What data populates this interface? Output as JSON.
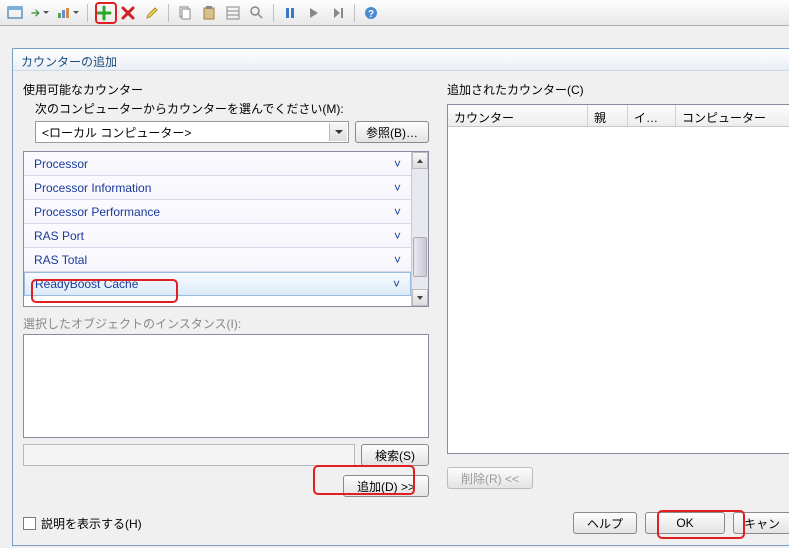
{
  "toolbar": {
    "icons": [
      "view-window",
      "arrow-right",
      "graph-type",
      "plus",
      "delete-x",
      "pencil",
      "copy",
      "paste",
      "clipboard",
      "zoom",
      "pause",
      "play",
      "step",
      "help"
    ]
  },
  "dialog": {
    "title": "カウンターの追加",
    "left": {
      "available_label": "使用可能なカウンター",
      "computer_label": "次のコンピューターからカウンターを選んでください(M):",
      "computer_value": "<ローカル コンピューター>",
      "browse_btn": "参照(B)…",
      "counters": [
        "Processor",
        "Processor Information",
        "Processor Performance",
        "RAS Port",
        "RAS Total",
        "ReadyBoost Cache"
      ],
      "instance_label": "選択したオブジェクトのインスタンス(I):",
      "search_btn": "検索(S)",
      "add_btn": "追加(D) >>"
    },
    "right": {
      "added_label": "追加されたカウンター(C)",
      "columns": [
        "カウンター",
        "親",
        "インス…",
        "コンピューター"
      ],
      "delete_btn": "削除(R) <<"
    },
    "show_desc": "説明を表示する(H)",
    "help_btn": "ヘルプ",
    "ok_btn": "OK",
    "cancel_btn": "キャン"
  }
}
